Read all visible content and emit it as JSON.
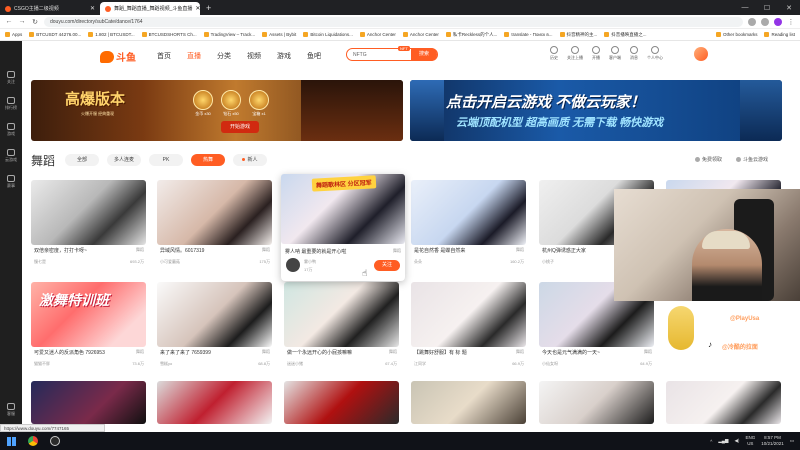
{
  "browser": {
    "tabs": [
      {
        "label": "CSGO主播二级视频",
        "active": false
      },
      {
        "label": "舞蹈_舞蹈直播_舞蹈视频_斗鱼直播",
        "active": true
      }
    ],
    "url": "douyu.com/directory/subCate/dance/1764",
    "bookmarks": [
      "Apps",
      "BTCUSDT 44276.00...",
      "1.802 | BTCUSDT...",
      "BTCUSDSHORTS Ch...",
      "TradingView – Track...",
      "Assets | Bybit",
      "Bitcoin Liquidations...",
      "Anchor Center",
      "Anchor Center",
      "私卡Reckless的个人...",
      "translate - Поиск в...",
      "抖音精神的主...",
      "抖音播映直播之..."
    ],
    "bookmarks_right": [
      "Other bookmarks",
      "Reading list"
    ]
  },
  "sidebar": [
    {
      "label": "关注",
      "icon": "heart-icon"
    },
    {
      "label": "排行榜",
      "icon": "ranking-icon"
    },
    {
      "label": "游戏",
      "icon": "game-icon"
    },
    {
      "label": "云游戏",
      "icon": "cloud-game-icon"
    },
    {
      "label": "赛事",
      "icon": "trophy-icon"
    },
    {
      "label": "客服",
      "icon": "service-icon"
    }
  ],
  "header": {
    "logo": "斗鱼",
    "nav": [
      "首页",
      "直播",
      "分类",
      "视频",
      "游戏",
      "鱼吧"
    ],
    "nav_active": 1,
    "search_placeholder": "NFTG",
    "search_button": "搜索",
    "hot_badge": "NFT",
    "user_items": [
      "历史",
      "关注上播",
      "开播",
      "客户端",
      "消息",
      "个人中心"
    ]
  },
  "banner1": {
    "title": "高爆版本",
    "subtitle": "火爆开服 经典重现",
    "items": [
      "金币 x30",
      "钻石 x50",
      "宝箱 x1"
    ],
    "button": "开始游戏"
  },
  "banner2": {
    "title": "点击开启云游戏 不做云玩家！",
    "subtitle": "云端顶配机型 超高画质 无需下载 畅快游戏"
  },
  "category": {
    "title": "舞蹈",
    "filters": [
      "全部",
      "多人连麦",
      "PK",
      "热舞",
      "新人"
    ],
    "active_filter": 3,
    "side_links": [
      "免费领取",
      "斗鱼云游戏"
    ]
  },
  "cards": [
    {
      "title": "双倍亲密度，打打卡呀~",
      "cat": "舞蹈",
      "name": "慢七是",
      "heat": "693.2万",
      "gfx": "g1"
    },
    {
      "title": "异域风情。6017319",
      "cat": "舞蹈",
      "name": "小可爱蘑菇",
      "heat": "175万",
      "gfx": "g2"
    },
    {
      "title": "是花自然香 是蝶自然来",
      "cat": "舞蹈",
      "name": "朵朵",
      "heat": "160.2万",
      "gfx": "g4"
    },
    {
      "title": "杭州Q弹诱惑正大家",
      "cat": "舞蹈",
      "name": "小桃子",
      "heat": "52.5万",
      "gfx": "g5"
    },
    {
      "title": "可爱又迷人的反派角色 7926953",
      "cat": "舞蹈",
      "name": "猫猫不胖",
      "heat": "73.6万",
      "gfx": "g6",
      "promo": "激舞特训班"
    },
    {
      "title": "来了来了来了 7659399",
      "cat": "舞蹈",
      "name": "雪糕yo",
      "heat": "68.8万",
      "gfx": "g7"
    },
    {
      "title": "做一个永远开心的小屁孩嘛嘛",
      "cat": "舞蹈",
      "name": "迷迷小猪",
      "heat": "67.4万",
      "gfx": "g8"
    },
    {
      "title": "【跳舞好舒服】有 标 题",
      "cat": "舞蹈",
      "name": "江同学",
      "heat": "66.9万",
      "gfx": "g9"
    },
    {
      "title": "今天也是元气满满的一天~",
      "cat": "舞蹈",
      "name": "小仙女呀",
      "heat": "64.9万",
      "gfx": "g10"
    }
  ],
  "hover_card": {
    "badge": "舞蹈歌林区 分区冠军",
    "title": "雾人呐 最重要的就是开心啦",
    "cat": "舞蹈",
    "name": "雾小鸭",
    "heat": "17万",
    "follow": "关注"
  },
  "webcam": {
    "tiktok_name": "@冷酷的拉面",
    "tiktok_top": "@PlayUsa",
    "tiktok_logo": "♪"
  },
  "status_url": "https://www.douyu.com/7747165",
  "taskbar": {
    "lang": "ENG",
    "region": "US",
    "time": "8:57 PM",
    "date": "10/21/2021"
  },
  "colors": {
    "brand": "#ff5d23",
    "taskbar": "#101218",
    "chrome_dark": "#202124"
  }
}
